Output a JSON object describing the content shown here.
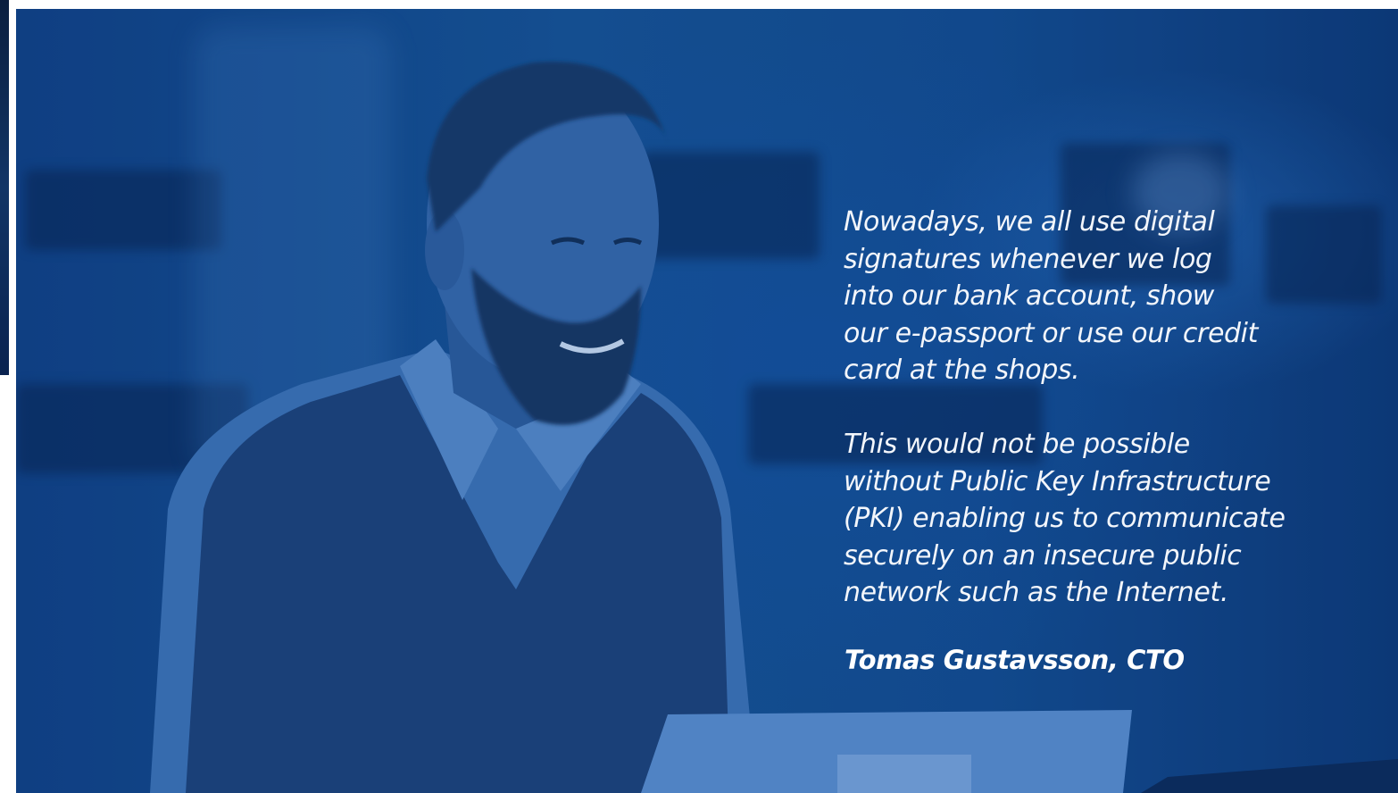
{
  "quote": {
    "paragraph_1": [
      "Nowadays, we all use digital",
      "signatures whenever we log",
      "into our bank account, show",
      "our e-passport or use our credit",
      "card at the shops."
    ],
    "paragraph_2": [
      "This would not be possible",
      "without Public Key Infrastructure",
      "(PKI) enabling us to communicate",
      "securely on an insecure public",
      "network such as the Internet."
    ]
  },
  "attribution": "Tomas Gustavsson, CTO",
  "colors": {
    "overlay_blue": "#15508f",
    "text": "#f3f6fb"
  }
}
